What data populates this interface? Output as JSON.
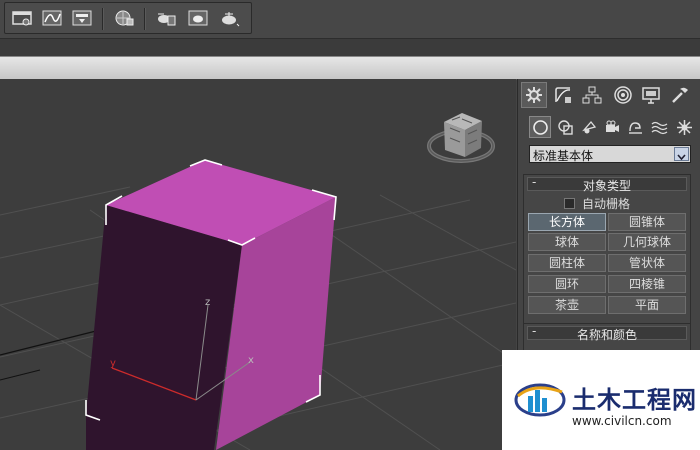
{
  "colors": {
    "box_front": "#2f142d",
    "box_side": "#a7449a",
    "box_top": "#c04eb4",
    "axis_x": "#cc2b2b",
    "logo_text": "#1a2c6e",
    "logo_accent": "#e8a317"
  },
  "toolbar": {
    "icons": [
      "scene-explorer-icon",
      "curve-editor-icon",
      "schematic-view-icon",
      "material-editor-icon",
      "render-setup-icon",
      "rendered-frame-icon",
      "render-icon"
    ]
  },
  "viewport": {
    "axis_labels": {
      "x": "x",
      "y": "y",
      "z": "z"
    }
  },
  "command_panel": {
    "tabs": [
      "create-tab-icon",
      "modify-tab-icon",
      "hierarchy-tab-icon",
      "motion-tab-icon",
      "display-tab-icon",
      "utilities-tab-icon"
    ],
    "subcategories": [
      "geometry-icon",
      "shapes-icon",
      "lights-icon",
      "cameras-icon",
      "helpers-icon",
      "space-warps-icon",
      "systems-icon"
    ],
    "dropdown_value": "标准基本体",
    "object_type": {
      "title": "对象类型",
      "minus": "-",
      "autogrid_label": "自动栅格",
      "buttons": [
        {
          "label": "长方体",
          "active": true
        },
        {
          "label": "圆锥体",
          "active": false
        },
        {
          "label": "球体",
          "active": false
        },
        {
          "label": "几何球体",
          "active": false
        },
        {
          "label": "圆柱体",
          "active": false
        },
        {
          "label": "管状体",
          "active": false
        },
        {
          "label": "圆环",
          "active": false
        },
        {
          "label": "四棱锥",
          "active": false
        },
        {
          "label": "茶壶",
          "active": false
        },
        {
          "label": "平面",
          "active": false
        }
      ]
    },
    "name_color": {
      "title": "名称和颜色",
      "minus": "-"
    }
  },
  "watermark": {
    "title": "土木工程网",
    "url": "www.civilcn.com"
  }
}
